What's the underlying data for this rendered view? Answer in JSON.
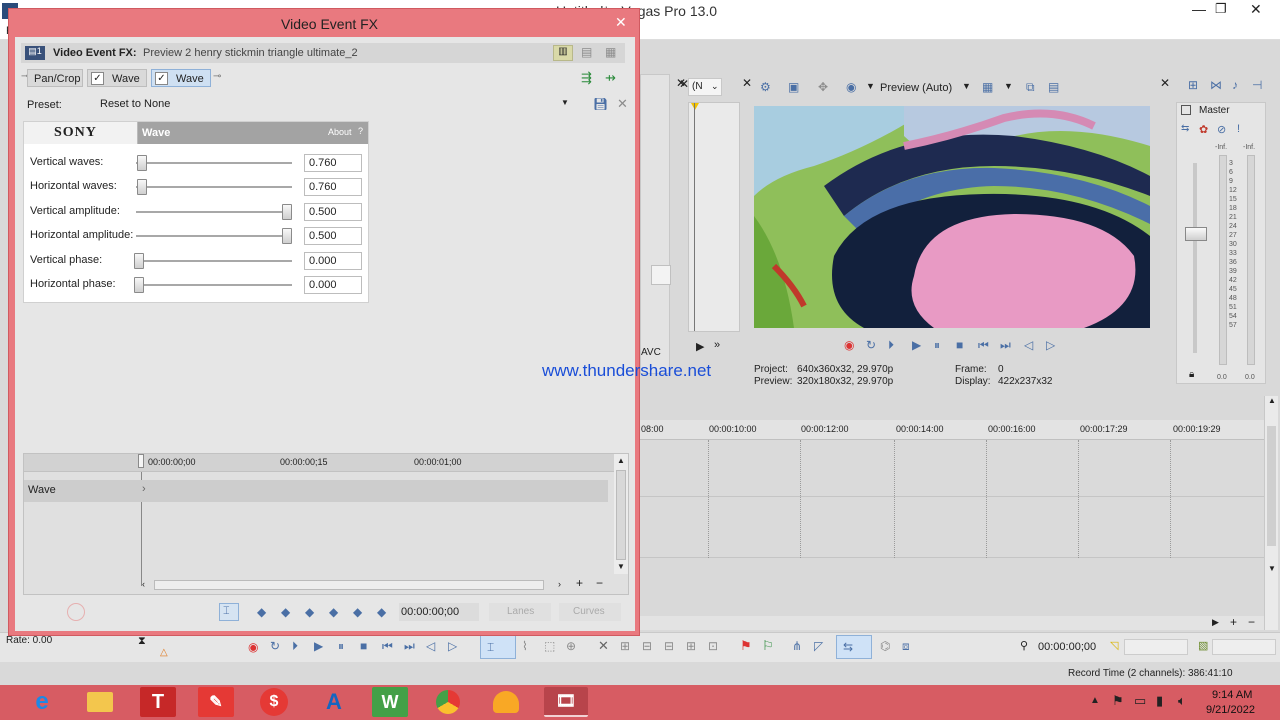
{
  "vegas": {
    "title": "Untitled* - Vegas Pro 13.0",
    "menu_first": "F",
    "rate": "Rate: 0.00",
    "record_time": "Record Time (2 channels): 386:41:10",
    "timecode": "00:00:00;00",
    "timeline_times": [
      "08:00",
      "00:00:10:00",
      "00:00:12:00",
      "00:00:14:00",
      "00:00:16:00",
      "00:00:17:29",
      "00:00:19:29"
    ],
    "preview": {
      "dropdown": "Preview (Auto)",
      "project_label": "Project:",
      "project_value": "640x360x32, 29.970p",
      "preview_label": "Preview:",
      "preview_value": "320x180x32, 29.970p",
      "frame_label": "Frame:",
      "frame_value": "0",
      "display_label": "Display:",
      "display_value": "422x237x32"
    },
    "mixer": {
      "title": "Master",
      "inf_left": "-Inf.",
      "inf_right": "-Inf.",
      "scale": [
        "3",
        "6",
        "9",
        "12",
        "15",
        "18",
        "21",
        "24",
        "27",
        "30",
        "33",
        "36",
        "39",
        "42",
        "45",
        "48",
        "51",
        "54",
        "57"
      ],
      "bottom_left": "0.0",
      "bottom_right": "0.0"
    },
    "avc_label": "AVC",
    "small_dropdown": "(N"
  },
  "watermark": "www.thundershare.net",
  "dialog": {
    "title": "Video Event FX",
    "header_label": "Video Event FX:",
    "header_value": "Preview 2 henry stickmin triangle ultimate_2",
    "chain": [
      "Pan/Crop",
      "Wave",
      "Wave"
    ],
    "preset_label": "Preset:",
    "preset_value": "Reset to None",
    "plugin_brand": "SONY",
    "plugin_name": "Wave",
    "about_label": "About",
    "params": [
      {
        "label": "Vertical waves:",
        "value": "0.760",
        "level": 0.02
      },
      {
        "label": "Horizontal waves:",
        "value": "0.760",
        "level": 0.02
      },
      {
        "label": "Vertical amplitude:",
        "value": "0.500",
        "level": 1.0
      },
      {
        "label": "Horizontal amplitude:",
        "value": "0.500",
        "level": 1.0
      },
      {
        "label": "Vertical phase:",
        "value": "0.000",
        "level": 0.0
      },
      {
        "label": "Horizontal phase:",
        "value": "0.000",
        "level": 0.0
      }
    ],
    "keyframe_times": [
      "00:00:00;00",
      "00:00:00;15",
      "00:00:01;00"
    ],
    "track_label": "Wave",
    "timecode": "00:00:00;00",
    "lanes_label": "Lanes",
    "curves_label": "Curves"
  },
  "taskbar": {
    "time": "9:14 AM",
    "date": "9/21/2022",
    "apps": [
      "internet-explorer",
      "file-explorer",
      "t-app",
      "red-app",
      "dollar-app",
      "a-app",
      "wunderlist-app",
      "chrome",
      "speed-app",
      "vegas-app"
    ]
  },
  "colors": {
    "dialog_frame": "#e9797f",
    "taskbar": "#d75c63",
    "watermark": "#1a4ed8"
  }
}
